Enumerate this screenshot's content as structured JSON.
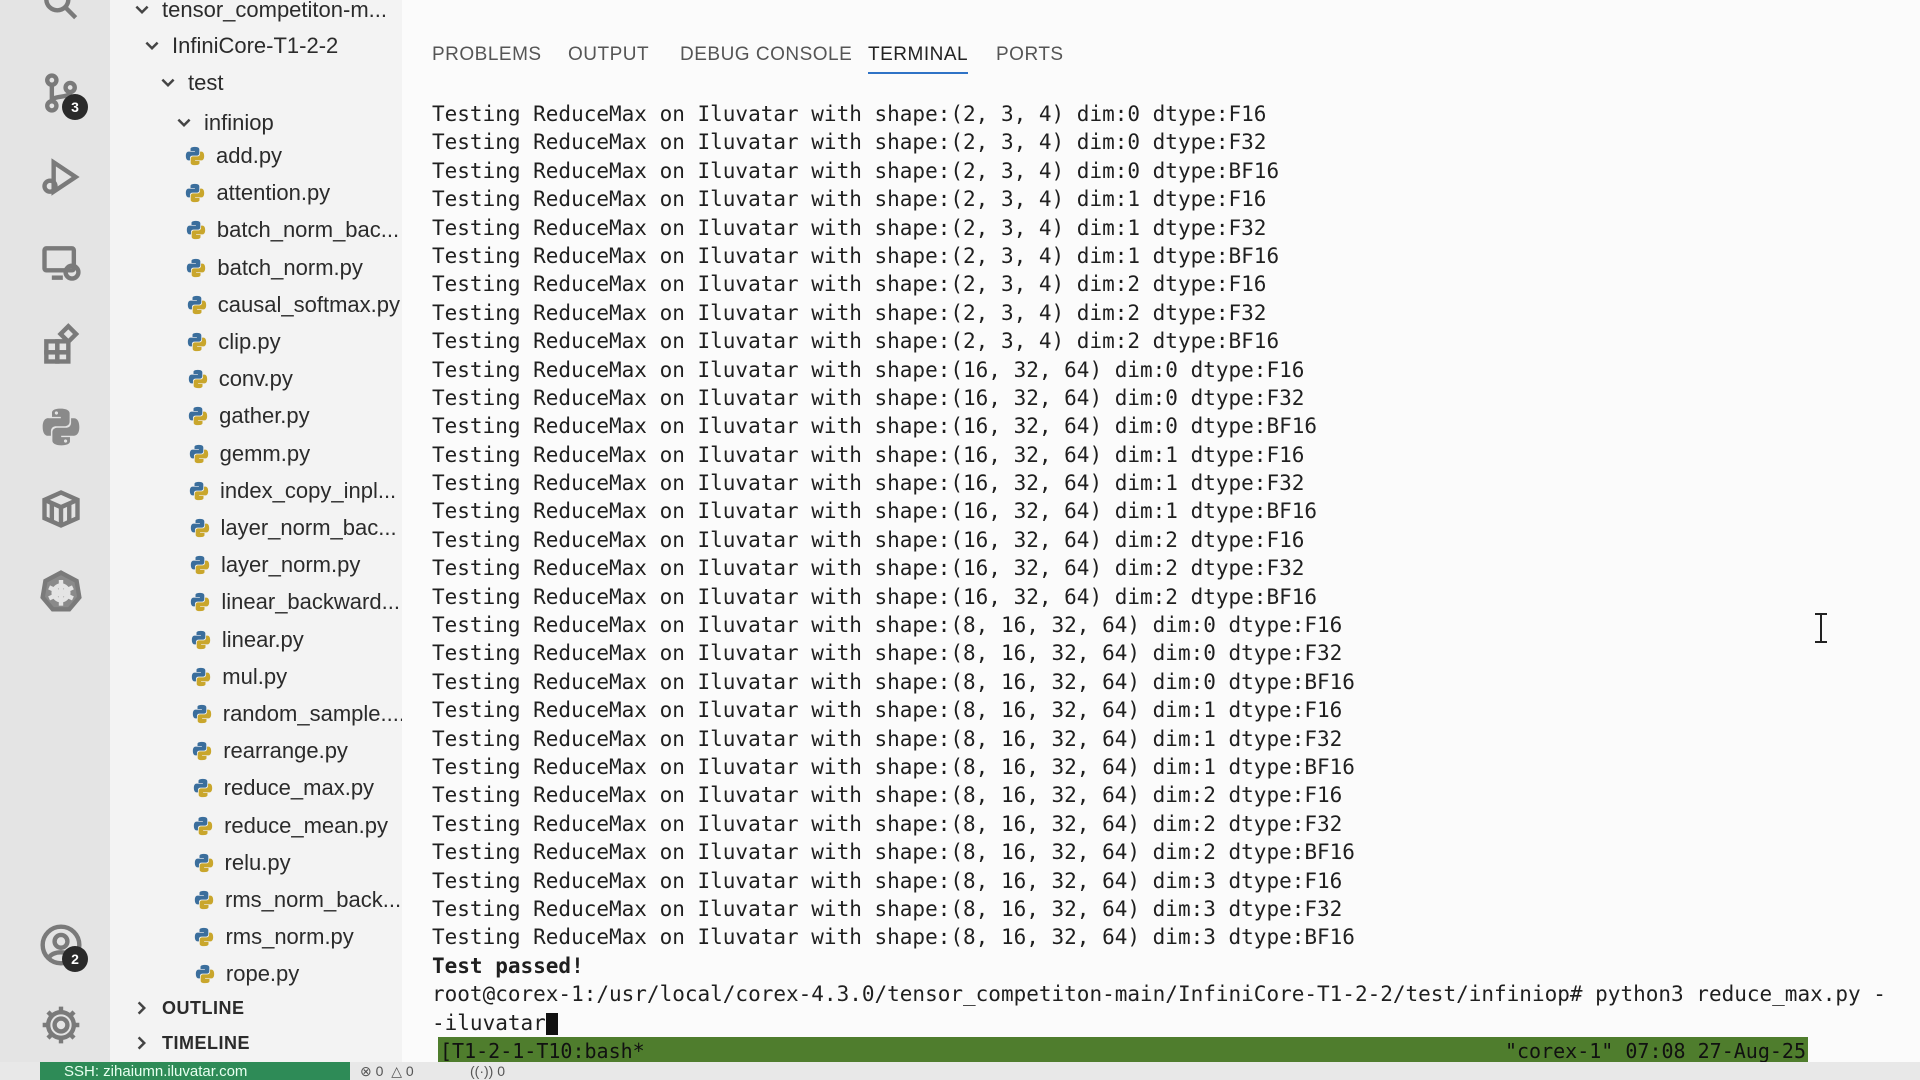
{
  "activity_bar": {
    "items": [
      {
        "icon": "search-icon"
      },
      {
        "icon": "source-control-icon",
        "badge": "3"
      },
      {
        "icon": "run-debug-icon"
      },
      {
        "icon": "remote-explorer-icon"
      },
      {
        "icon": "extensions-icon"
      },
      {
        "icon": "python-icon"
      },
      {
        "icon": "package-icon"
      },
      {
        "icon": "kubernetes-icon"
      },
      {
        "icon": "account-icon",
        "badge": "2"
      },
      {
        "icon": "gear-icon"
      }
    ]
  },
  "explorer": {
    "root": "tensor_competiton-m...",
    "project": "InfiniCore-T1-2-2",
    "test_folder": "test",
    "infiniop_folder": "infiniop",
    "files": [
      "add.py",
      "attention.py",
      "batch_norm_bac...",
      "batch_norm.py",
      "causal_softmax.py",
      "clip.py",
      "conv.py",
      "gather.py",
      "gemm.py",
      "index_copy_inpl...",
      "layer_norm_bac...",
      "layer_norm.py",
      "linear_backward...",
      "linear.py",
      "mul.py",
      "random_sample....",
      "rearrange.py",
      "reduce_max.py",
      "reduce_mean.py",
      "relu.py",
      "rms_norm_back...",
      "rms_norm.py",
      "rope.py"
    ],
    "outline_label": "OUTLINE",
    "timeline_label": "TIMELINE"
  },
  "panel": {
    "tabs": [
      {
        "label": "PROBLEMS",
        "active": false
      },
      {
        "label": "OUTPUT",
        "active": false
      },
      {
        "label": "DEBUG CONSOLE",
        "active": false
      },
      {
        "label": "TERMINAL",
        "active": true
      },
      {
        "label": "PORTS",
        "active": false
      }
    ],
    "accent_color": "#2f73c6"
  },
  "terminal": {
    "lines": [
      "Testing ReduceMax on Iluvatar with shape:(2, 3, 4) dim:0 dtype:F16",
      "Testing ReduceMax on Iluvatar with shape:(2, 3, 4) dim:0 dtype:F32",
      "Testing ReduceMax on Iluvatar with shape:(2, 3, 4) dim:0 dtype:BF16",
      "Testing ReduceMax on Iluvatar with shape:(2, 3, 4) dim:1 dtype:F16",
      "Testing ReduceMax on Iluvatar with shape:(2, 3, 4) dim:1 dtype:F32",
      "Testing ReduceMax on Iluvatar with shape:(2, 3, 4) dim:1 dtype:BF16",
      "Testing ReduceMax on Iluvatar with shape:(2, 3, 4) dim:2 dtype:F16",
      "Testing ReduceMax on Iluvatar with shape:(2, 3, 4) dim:2 dtype:F32",
      "Testing ReduceMax on Iluvatar with shape:(2, 3, 4) dim:2 dtype:BF16",
      "Testing ReduceMax on Iluvatar with shape:(16, 32, 64) dim:0 dtype:F16",
      "Testing ReduceMax on Iluvatar with shape:(16, 32, 64) dim:0 dtype:F32",
      "Testing ReduceMax on Iluvatar with shape:(16, 32, 64) dim:0 dtype:BF16",
      "Testing ReduceMax on Iluvatar with shape:(16, 32, 64) dim:1 dtype:F16",
      "Testing ReduceMax on Iluvatar with shape:(16, 32, 64) dim:1 dtype:F32",
      "Testing ReduceMax on Iluvatar with shape:(16, 32, 64) dim:1 dtype:BF16",
      "Testing ReduceMax on Iluvatar with shape:(16, 32, 64) dim:2 dtype:F16",
      "Testing ReduceMax on Iluvatar with shape:(16, 32, 64) dim:2 dtype:F32",
      "Testing ReduceMax on Iluvatar with shape:(16, 32, 64) dim:2 dtype:BF16",
      "Testing ReduceMax on Iluvatar with shape:(8, 16, 32, 64) dim:0 dtype:F16",
      "Testing ReduceMax on Iluvatar with shape:(8, 16, 32, 64) dim:0 dtype:F32",
      "Testing ReduceMax on Iluvatar with shape:(8, 16, 32, 64) dim:0 dtype:BF16",
      "Testing ReduceMax on Iluvatar with shape:(8, 16, 32, 64) dim:1 dtype:F16",
      "Testing ReduceMax on Iluvatar with shape:(8, 16, 32, 64) dim:1 dtype:F32",
      "Testing ReduceMax on Iluvatar with shape:(8, 16, 32, 64) dim:1 dtype:BF16",
      "Testing ReduceMax on Iluvatar with shape:(8, 16, 32, 64) dim:2 dtype:F16",
      "Testing ReduceMax on Iluvatar with shape:(8, 16, 32, 64) dim:2 dtype:F32",
      "Testing ReduceMax on Iluvatar with shape:(8, 16, 32, 64) dim:2 dtype:BF16",
      "Testing ReduceMax on Iluvatar with shape:(8, 16, 32, 64) dim:3 dtype:F16",
      "Testing ReduceMax on Iluvatar with shape:(8, 16, 32, 64) dim:3 dtype:F32",
      "Testing ReduceMax on Iluvatar with shape:(8, 16, 32, 64) dim:3 dtype:BF16"
    ],
    "result": "Test passed!",
    "prompt_line": "root@corex-1:/usr/local/corex-4.3.0/tensor_competiton-main/InfiniCore-T1-2-2/test/infiniop# python3 reduce_max.py -",
    "prompt_continuation": "-iluvatar",
    "tmux_left": "[T1-2-1-T10:bash*",
    "tmux_right": "\"corex-1\" 07:08 27-Aug-25",
    "tmux_color": "#4f7d2d"
  },
  "status_bar": {
    "remote_label": "SSH: zihaiumn.iluvatar.com",
    "errors": "0",
    "warnings": "0",
    "ports": "0",
    "remote_color": "#2e8b57"
  }
}
